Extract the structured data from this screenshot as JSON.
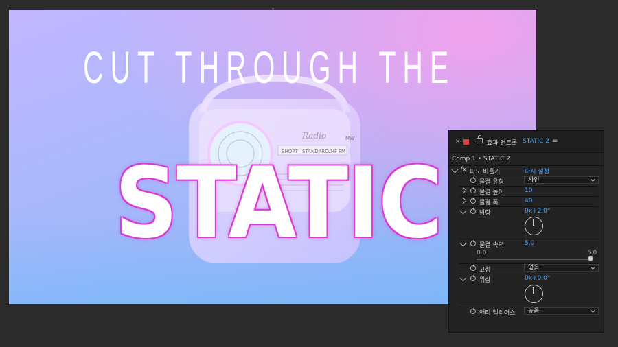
{
  "composition": {
    "headline_top": "CUT THROUGH THE",
    "headline_main": "STATIC",
    "radio_dial_labels": [
      "Radio",
      "SHORT",
      "STANDARD",
      "VHF",
      "FM",
      "MW"
    ]
  },
  "effect_controls": {
    "panel_title": "효과 컨트롤",
    "layer_name": "STATIC 2",
    "comp_path": "Comp 1 • STATIC 2",
    "effect": {
      "fx_label": "fx",
      "name": "파도 비틀기",
      "reset_label": "다시 설정"
    },
    "props": {
      "wave_type": {
        "label": "물결 유형",
        "value": "사인"
      },
      "wave_height": {
        "label": "물결 높이",
        "value": "10"
      },
      "wave_width": {
        "label": "물결 폭",
        "value": "40"
      },
      "direction": {
        "label": "방향",
        "value": "0x+2.0°"
      },
      "wave_speed": {
        "label": "물결 속력",
        "value": "5.0",
        "slider_min": "0.0",
        "slider_max": "5.0",
        "fraction": 1.0
      },
      "pinning": {
        "label": "고정",
        "value": "없음"
      },
      "phase": {
        "label": "위상",
        "value": "0x+0.0°"
      },
      "antialiasing": {
        "label": "앤티 앨리어스",
        "value": "높음"
      }
    }
  },
  "colors": {
    "accent_blue": "#4aa3ff",
    "outline_magenta": "#d93ad1",
    "label_red": "#d93a3a"
  }
}
